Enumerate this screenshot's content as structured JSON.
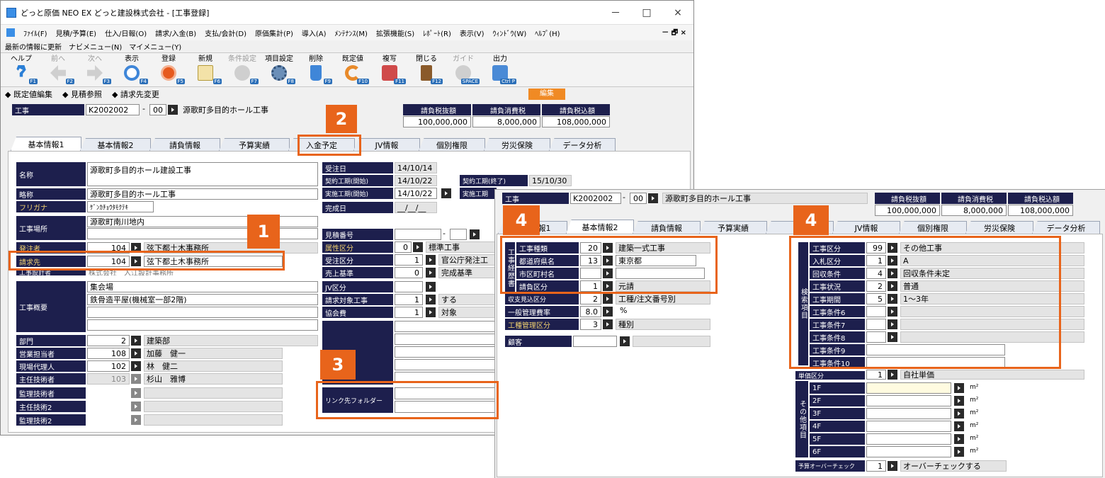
{
  "window": {
    "title": "どっと原価 NEO EX どっと建設株式会社 - [工事登録]",
    "minimize": "－",
    "maximize": "□",
    "close": "×"
  },
  "menu": [
    "ﾌｧｲﾙ(F)",
    "見積/予算(E)",
    "仕入/日報(O)",
    "請求/入金(B)",
    "支払/会計(D)",
    "原価集計(P)",
    "導入(A)",
    "ﾒﾝﾃﾅﾝｽ(M)",
    "拡張機能(S)",
    "ﾚﾎﾟｰﾄ(R)",
    "表示(V)",
    "ｳｨﾝﾄﾞｳ(W)",
    "ﾍﾙﾌﾟ(H)"
  ],
  "menu_mdi": "－ 🗗 ×",
  "nav": [
    "最新の情報に更新",
    "ナビメニュー(N)",
    "マイメニュー(Y)"
  ],
  "toolbar": [
    {
      "label": "ヘルプ",
      "key": "F1",
      "color": "#2b7fd6",
      "disabled": false
    },
    {
      "label": "前へ",
      "key": "F2",
      "color": "#b0b0b0",
      "disabled": true
    },
    {
      "label": "次へ",
      "key": "F3",
      "color": "#b0b0b0",
      "disabled": true
    },
    {
      "label": "表示",
      "key": "F4",
      "color": "#3f86d8",
      "disabled": false
    },
    {
      "label": "登録",
      "key": "F5",
      "color": "#e65a1e",
      "disabled": false
    },
    {
      "label": "新規",
      "key": "F6",
      "color": "#d7b24a",
      "disabled": false
    },
    {
      "label": "条件設定",
      "key": "F7",
      "color": "#c4c4c4",
      "disabled": true
    },
    {
      "label": "項目設定",
      "key": "F8",
      "color": "#6b8fb8",
      "disabled": false
    },
    {
      "label": "削除",
      "key": "F9",
      "color": "#3f86d8",
      "disabled": false
    },
    {
      "label": "既定値",
      "key": "F10",
      "color": "#e88a2a",
      "disabled": false
    },
    {
      "label": "複写",
      "key": "F11",
      "color": "#d04a4a",
      "disabled": false
    },
    {
      "label": "閉じる",
      "key": "F12",
      "color": "#8a5a2a",
      "disabled": false
    },
    {
      "label": "ガイド",
      "key": "SPACE",
      "color": "#cfcfcf",
      "disabled": true
    },
    {
      "label": "出力",
      "key": "Ctrl P",
      "color": "#4a8ad6",
      "disabled": false
    }
  ],
  "subbar": [
    "既定値編集",
    "見積参照",
    "請求先変更"
  ],
  "edit_badge": "編集",
  "header": {
    "koji_label": "工事",
    "koji_code": "K2002002",
    "koji_dash": "-",
    "koji_branch": "00",
    "koji_name": "源歌町多目的ホール工事",
    "amount_labels": [
      "請負税抜額",
      "請負消費税",
      "請負税込額"
    ],
    "amounts": [
      "100,000,000",
      "8,000,000",
      "108,000,000"
    ]
  },
  "tabs": [
    "基本情報1",
    "基本情報2",
    "請負情報",
    "予算実績",
    "入金予定",
    "JV情報",
    "個別権限",
    "労災保険",
    "データ分析"
  ],
  "left_fields": {
    "name_label": "名称",
    "name_value": "源歌町多目的ホール建設工事",
    "short_label": "略称",
    "short_value": "源歌町多目的ホール工事",
    "kana_label": "フリガナ",
    "kana_value": "ｹﾞﾝｶﾁｮｳﾀﾓｸﾃｷ",
    "place_label": "工事場所",
    "place_value": "源歌町南川地内",
    "orderer_label": "発注者",
    "orderer_code": "104",
    "orderer_name": "弦下都土木事務所",
    "billto_label": "請求先",
    "billto_code": "104",
    "billto_name": "弦下都土木事務所",
    "designer_label": "工事設計者",
    "designer_value": "株式会社　入江設計事務所",
    "summary_label": "工事概要",
    "summary_line1": "集会場",
    "summary_line2": "鉄骨造平屋(機械室一部2階)",
    "dept_label": "部門",
    "dept_code": "2",
    "dept_name": "建築部",
    "sales_label": "営業担当者",
    "sales_code": "108",
    "sales_name": "加藤　健一",
    "site_label": "現場代理人",
    "site_code": "102",
    "site_name": "林　健二",
    "chief_label": "主任技術者",
    "chief_code": "103",
    "chief_name": "杉山　雅博",
    "supervisor_label": "監理技術者",
    "chief2_label": "主任技術2",
    "supervisor2_label": "監理技術2"
  },
  "mid_fields": {
    "order_date_label": "受注日",
    "order_date": "14/10/14",
    "contract_start_label": "契約工期(開始)",
    "contract_start": "14/10/22",
    "contract_end_label": "契約工期(終了)",
    "contract_end": "15/10/30",
    "actual_start_label": "実施工期(開始)",
    "actual_start": "14/10/22",
    "actual_end_label": "実施工期",
    "complete_label": "完成日",
    "complete_value": "__/__/__",
    "estimate_label": "見積番号",
    "estimate_dash": "-",
    "class_label": "属性区分",
    "class_code": "0",
    "class_name": "標準工事",
    "receive_label": "受注区分",
    "receive_code": "1",
    "receive_name": "官公庁発注工",
    "sales_std_label": "売上基準",
    "sales_std_code": "0",
    "sales_std_name": "完成基準",
    "jv_label": "JV区分",
    "billing_label": "請求対象工事",
    "billing_code": "1",
    "billing_name": "する",
    "assoc_label": "協会費",
    "assoc_code": "1",
    "assoc_name": "対象",
    "link_label": "リンク先フォルダー"
  },
  "second": {
    "koji_label": "工事",
    "koji_code": "K2002002",
    "koji_dash": "-",
    "koji_branch": "00",
    "koji_name": "源歌町多目的ホール工事",
    "amount_labels": [
      "請負税抜額",
      "請負消費税",
      "請負税込額"
    ],
    "amounts": [
      "100,000,000",
      "8,000,000",
      "108,000,000"
    ],
    "tabs": [
      "基本情報1",
      "基本情報2",
      "請負情報",
      "予算実績",
      "入",
      "JV情報",
      "個別権限",
      "労災保険",
      "データ分析"
    ],
    "group1_label": "工事経歴書",
    "kind_label": "工事種類",
    "kind_code": "20",
    "kind_name": "建築一式工事",
    "pref_label": "都道府県名",
    "pref_code": "13",
    "pref_name": "東京都",
    "city_label": "市区町村名",
    "contract_label": "請負区分",
    "contract_code": "1",
    "contract_name": "元請",
    "income_label": "収支見込区分",
    "income_code": "2",
    "income_name": "工種/注文番号別",
    "overhead_label": "一般管理費率",
    "overhead_value": "8.0",
    "overhead_unit": "%",
    "mgmt_label": "工種管理区分",
    "mgmt_code": "3",
    "mgmt_name": "種別",
    "customer_label": "顧客",
    "group2_label": "検索項目",
    "group3_label": "その他項目",
    "search_rows": [
      {
        "label": "工事区分",
        "code": "99",
        "name": "その他工事"
      },
      {
        "label": "入札区分",
        "code": "1",
        "name": "A"
      },
      {
        "label": "回収条件",
        "code": "4",
        "name": "回収条件未定"
      },
      {
        "label": "工事状況",
        "code": "2",
        "name": "普通"
      },
      {
        "label": "工事期間",
        "code": "5",
        "name": "1～3年"
      },
      {
        "label": "工事条件6",
        "code": "",
        "name": ""
      },
      {
        "label": "工事条件7",
        "code": "",
        "name": ""
      },
      {
        "label": "工事条件8",
        "code": "",
        "name": ""
      },
      {
        "label": "工事条件9",
        "code": "",
        "name": ""
      },
      {
        "label": "工事条件10",
        "code": "",
        "name": ""
      }
    ],
    "unit_price_label": "単価区分",
    "unit_price_code": "1",
    "unit_price_name": "自社単価",
    "floors": [
      "1F",
      "2F",
      "3F",
      "4F",
      "5F",
      "6F"
    ],
    "floor_unit": "m²",
    "overcheck_label": "予算オーバーチェック",
    "overcheck_code": "1",
    "overcheck_name": "オーバーチェックする"
  },
  "badges": [
    "1",
    "2",
    "3",
    "4",
    "4"
  ]
}
